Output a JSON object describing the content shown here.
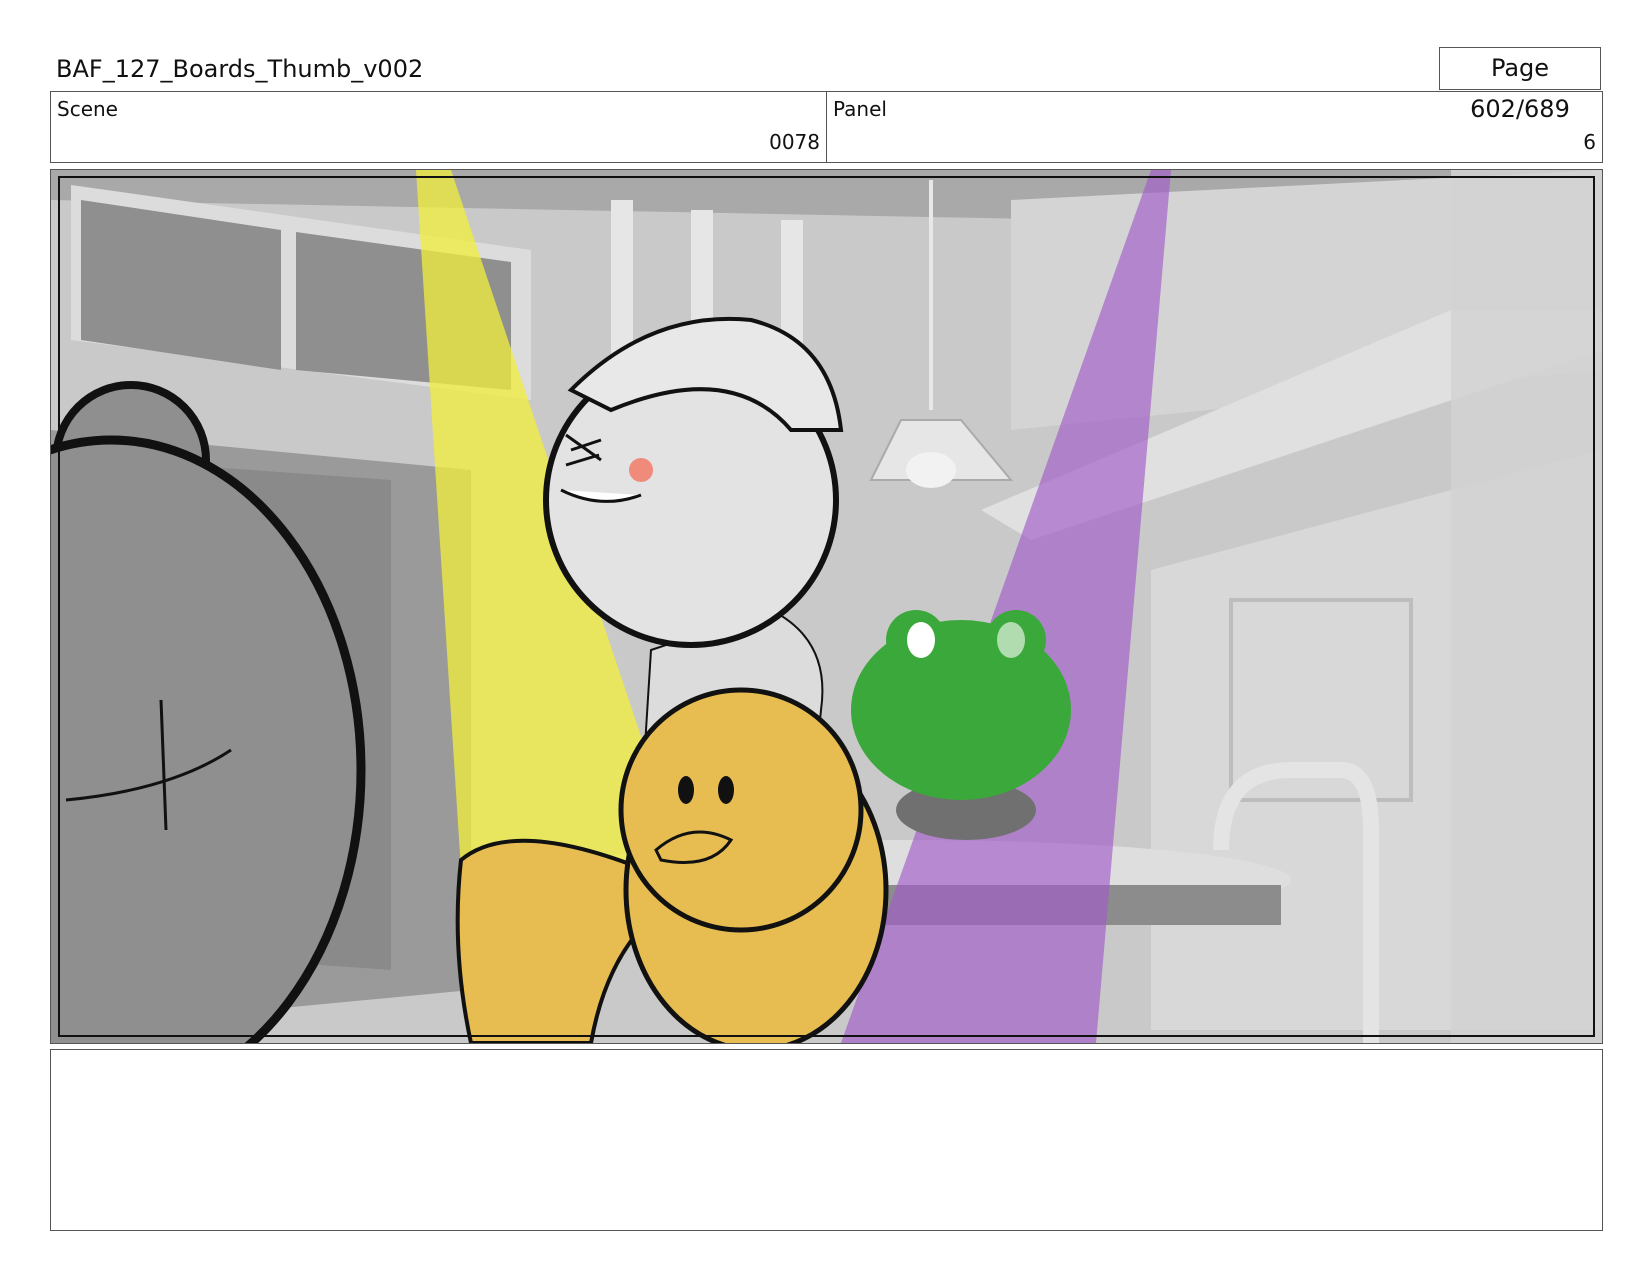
{
  "document": {
    "title": "BAF_127_Boards_Thumb_v002",
    "page_label": "Page 602/689"
  },
  "meta": {
    "scene_label": "Scene",
    "scene_value": "0078",
    "panel_label": "Panel",
    "panel_value": "6"
  },
  "frame": {
    "description_colors": {
      "yellow_light": "#f2ee3a",
      "purple_light": "#a05bc8",
      "duck": "#e7bd52",
      "frog": "#3aa83a",
      "background_gray": "#c8c8c8"
    }
  },
  "notes": {
    "text": ""
  }
}
